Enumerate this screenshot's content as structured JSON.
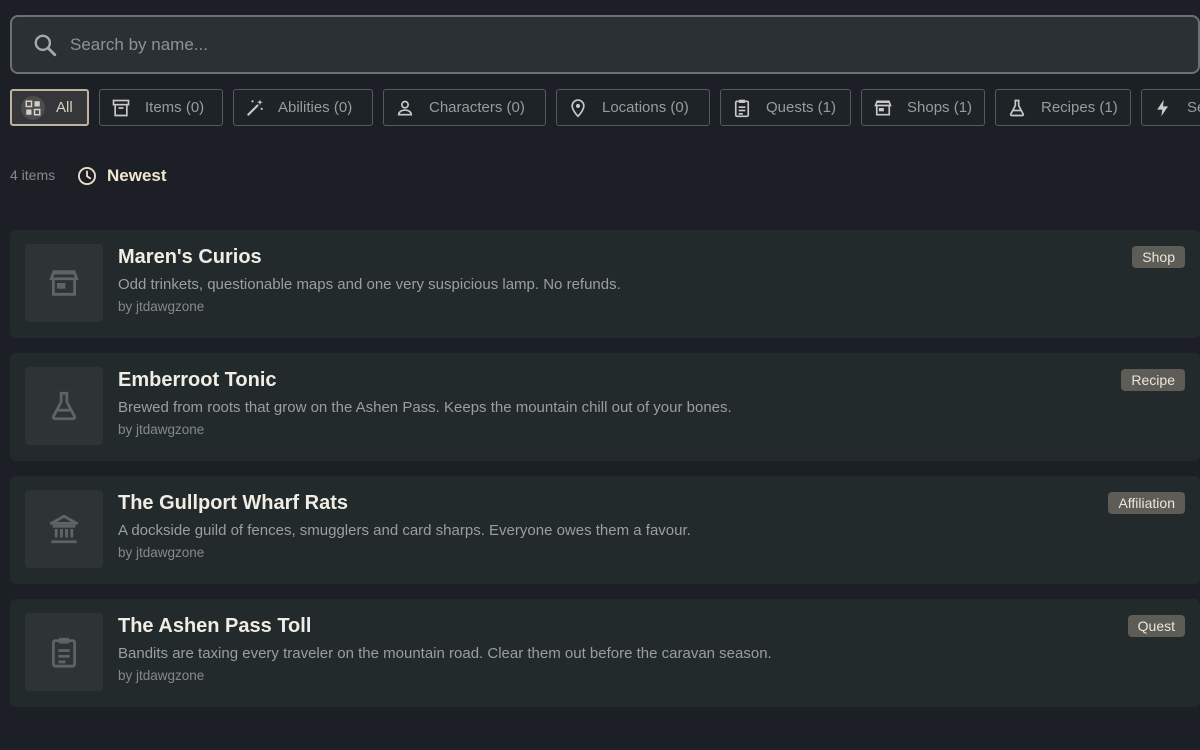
{
  "search": {
    "placeholder": "Search by name...",
    "value": ""
  },
  "filters": [
    {
      "label": "All",
      "icon": "grid-icon",
      "active": true
    },
    {
      "label": "Items (0)",
      "icon": "archive-icon"
    },
    {
      "label": "Abilities (0)",
      "icon": "magic-wand-icon"
    },
    {
      "label": "Characters (0)",
      "icon": "person-icon"
    },
    {
      "label": "Locations (0)",
      "icon": "map-pin-icon"
    },
    {
      "label": "Quests (1)",
      "icon": "clipboard-icon"
    },
    {
      "label": "Shops (1)",
      "icon": "store-icon"
    },
    {
      "label": "Recipes (1)",
      "icon": "flask-icon"
    },
    {
      "label": "Se",
      "icon": "lightning-icon"
    }
  ],
  "toolbar": {
    "count": "4 items",
    "sort_label": "Newest"
  },
  "entries": [
    {
      "title": "Maren's Curios",
      "description": "Odd trinkets, questionable maps and one very suspicious lamp. No refunds.",
      "author": "by jtdawgzone",
      "badge": "Shop",
      "icon": "store-icon"
    },
    {
      "title": "Emberroot Tonic",
      "description": "Brewed from roots that grow on the Ashen Pass. Keeps the mountain chill out of your bones.",
      "author": "by jtdawgzone",
      "badge": "Recipe",
      "icon": "flask-icon"
    },
    {
      "title": "The Gullport Wharf Rats",
      "description": "A dockside guild of fences, smugglers and card sharps. Everyone owes them a favour.",
      "author": "by jtdawgzone",
      "badge": "Affiliation",
      "icon": "bank-icon"
    },
    {
      "title": "The Ashen Pass Toll",
      "description": "Bandits are taxing every traveler on the mountain road. Clear them out before the caravan season.",
      "author": "by jtdawgzone",
      "badge": "Quest",
      "icon": "clipboard-icon"
    }
  ],
  "colors": {
    "background": "#1c2026",
    "card": "#232a2c",
    "accent": "#bfb39b",
    "badge": "#5d5c57"
  }
}
